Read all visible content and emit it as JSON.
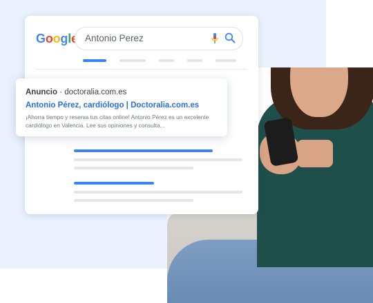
{
  "brand": {
    "logo_letters": [
      "G",
      "o",
      "o",
      "g",
      "l",
      "e"
    ],
    "logo_colors": [
      "#4285F4",
      "#EA4335",
      "#FBBC05",
      "#4285F4",
      "#34A853",
      "#EA4335"
    ]
  },
  "search": {
    "query": "Antonio Perez",
    "mic_icon": "mic-icon",
    "search_icon": "magnifier-icon"
  },
  "ad": {
    "label": "Anuncio",
    "separator": " · ",
    "domain": "doctoralia.com.es",
    "title": "Antonio Pérez, cardiólogo | Doctoralia.com.es",
    "description": "¡Ahorra tiempo y reserva tus citas online! Antonio Pérez es un excelente cardiólogo en Valencia. Lee sus opiniones y consulta..."
  },
  "colors": {
    "accent_blue": "#3b82f6",
    "link_blue": "#2a6fdb",
    "panel_bg": "#eaf1fd"
  }
}
